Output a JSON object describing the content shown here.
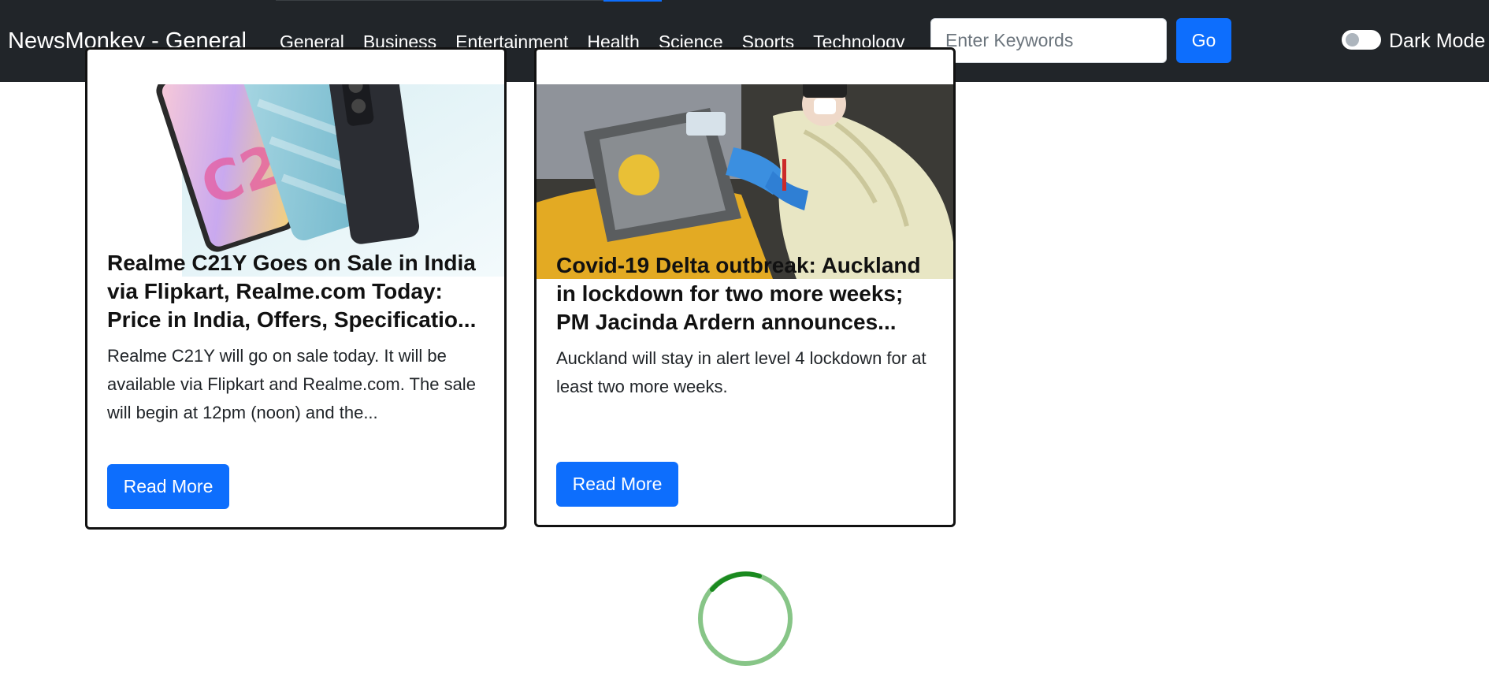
{
  "navbar": {
    "brand": "NewsMonkey - General",
    "links": [
      "General",
      "Business",
      "Entertainment",
      "Health",
      "Science",
      "Sports",
      "Technology"
    ],
    "search": {
      "placeholder": "Enter Keywords",
      "value": ""
    },
    "go_label": "Go",
    "dark_mode_label": "Dark Mode",
    "dark_mode_on": false
  },
  "articles": [
    {
      "title": "Realme C21Y Goes on Sale in India via Flipkart, Realme.com Today: Price in India, Offers, Specificatio...",
      "description": "Realme C21Y will go on sale today. It will be available via Flipkart and Realme.com. The sale will begin at 12pm (noon) and the...",
      "button": "Read More"
    },
    {
      "title": "Covid-19 Delta outbreak: Auckland in lockdown for two more weeks; PM Jacinda Ardern announces...",
      "description": "Auckland will stay in alert level 4 lockdown for at least two more weeks.",
      "button": "Read More"
    }
  ],
  "colors": {
    "navbar_bg": "#212529",
    "primary": "#0d6efd",
    "spinner": "#1a8a1f"
  },
  "icons": [
    "loading-spinner-icon",
    "toggle-switch-icon"
  ]
}
